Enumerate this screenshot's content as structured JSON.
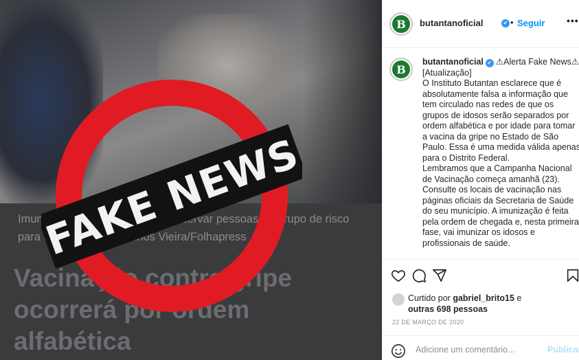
{
  "post": {
    "image": {
      "caption": "Imunização contra gripe visa preservar pessoas do grupo de risco para o coronavírus - Carlos Vieira/Folhapress",
      "headline": "Vacinação contra gripe ocorrerá por ordem alfabética",
      "stamp_text": "FAKE NEWS",
      "stamp_color": "#e01b24"
    }
  },
  "header": {
    "avatar_letter": "B",
    "username": "butantanoficial",
    "separator": "•",
    "follow_label": "Seguir",
    "more_label": "•••"
  },
  "comment": {
    "avatar_letter": "B",
    "username": "butantanoficial",
    "text": "⚠Alerta Fake News⚠\n[Atualização]\nO Instituto Butantan esclarece que é absolutamente falsa a informação que tem circulado nas redes de que os grupos de idosos serão separados por ordem alfabética e por idade para tomar a vacina da gripe no Estado de São Paulo. Essa é uma medida válida apenas para o Distrito Federal.\nLembramos que a Campanha Nacional de Vacinação começa amanhã (23). Consulte os locais de vacinação nas páginas oficiais da Secretaria de Saúde do seu município. A imunização é feita pela ordem de chegada e, nesta primeira fase, vai imunizar os idosos e profissionais de saúde."
  },
  "actions": {
    "icons": [
      "heart-icon",
      "comment-icon",
      "share-icon",
      "bookmark-icon"
    ],
    "likes_prefix": "Curtido por",
    "likes_user": "gabriel_brito15",
    "likes_joiner": "e",
    "likes_others": "outras 698 pessoas",
    "date": "22 DE MARÇO DE 2020",
    "comment_placeholder": "Adicione um comentário...",
    "publish_label": "Publicar"
  },
  "colors": {
    "brand_green": "#1c7a30",
    "link_blue": "#0095f6",
    "verified_blue": "#3897f0"
  }
}
